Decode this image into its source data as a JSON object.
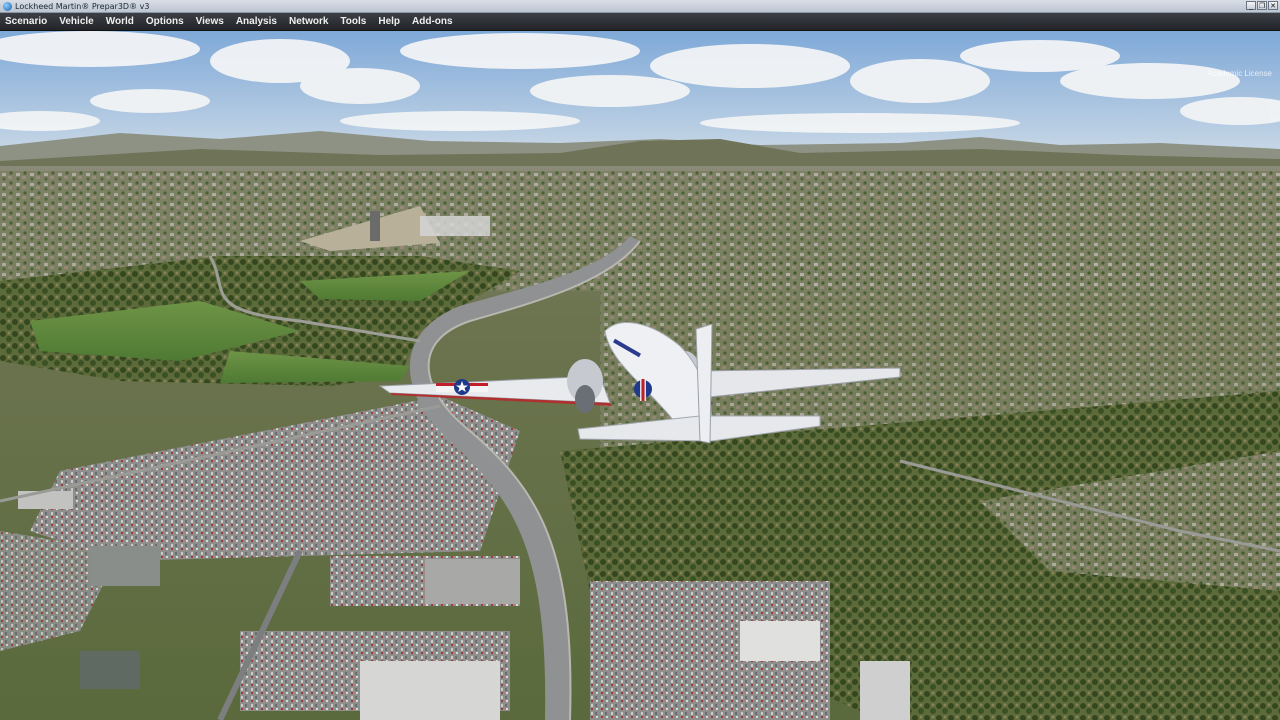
{
  "window": {
    "title": "Lockheed Martin® Prepar3D® v3",
    "controls": {
      "minimize": "_",
      "restore": "❐",
      "close": "✕"
    }
  },
  "menubar": {
    "items": [
      "Scenario",
      "Vehicle",
      "World",
      "Options",
      "Views",
      "Analysis",
      "Network",
      "Tools",
      "Help",
      "Add-ons"
    ]
  },
  "overlay": {
    "license": "Academic License"
  },
  "colors": {
    "sky": "#8fb7e0",
    "terrain": "#6f7f4e",
    "road": "#8a8c8e",
    "aircraft": "#e8eaee",
    "roundel_blue": "#1f3a8a",
    "roundel_red": "#c21f2b"
  }
}
